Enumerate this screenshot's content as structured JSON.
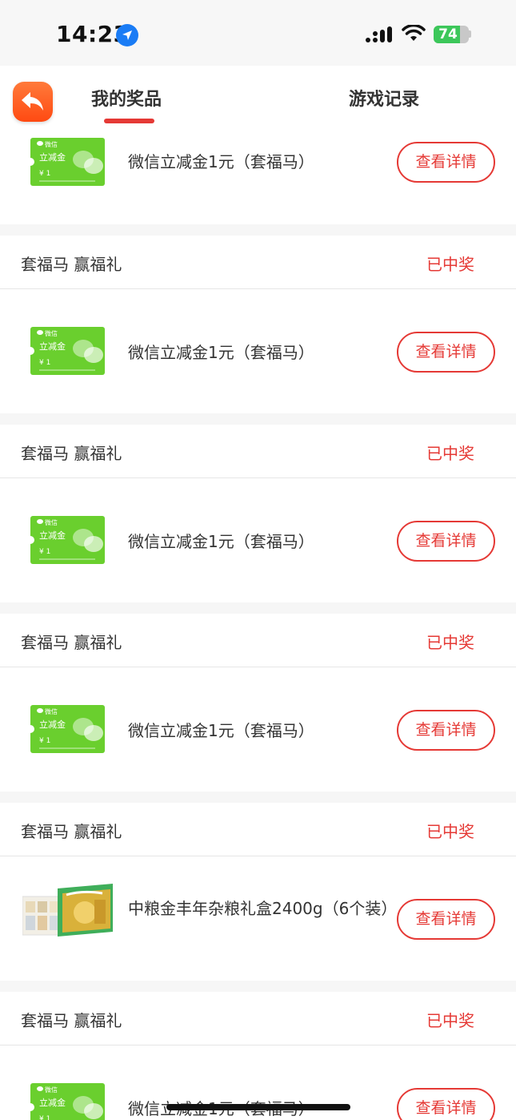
{
  "status_bar": {
    "time": "14:23",
    "battery": "74",
    "battery_level": 0.74
  },
  "header": {
    "tabs": [
      {
        "label": "我的奖品",
        "active": true
      },
      {
        "label": "游戏记录",
        "active": false
      }
    ]
  },
  "colors": {
    "accent": "#e53935",
    "back_button": "#ff5a1f",
    "wechat_green": "#6acf2e"
  },
  "first_card": {
    "image": "wechat-voucher",
    "name": "微信立减金1元（套福马）",
    "button": "查看详情"
  },
  "wechat_voucher": {
    "brand": "微信",
    "name": "立减金",
    "amount": "¥ 1"
  },
  "cards": [
    {
      "title": "套福马 赢福礼",
      "status": "已中奖",
      "image": "wechat-voucher",
      "name": "微信立减金1元（套福马）",
      "button": "查看详情"
    },
    {
      "title": "套福马 赢福礼",
      "status": "已中奖",
      "image": "wechat-voucher",
      "name": "微信立减金1元（套福马）",
      "button": "查看详情"
    },
    {
      "title": "套福马 赢福礼",
      "status": "已中奖",
      "image": "wechat-voucher",
      "name": "微信立减金1元（套福马）",
      "button": "查看详情"
    },
    {
      "title": "套福马 赢福礼",
      "status": "已中奖",
      "image": "grain-gift-box",
      "name": "中粮金丰年杂粮礼盒2400g（6个装）",
      "button": "查看详情"
    },
    {
      "title": "套福马 赢福礼",
      "status": "已中奖",
      "image": "wechat-voucher",
      "name": "微信立减金1元（套福马）",
      "button": "查看详情"
    }
  ]
}
